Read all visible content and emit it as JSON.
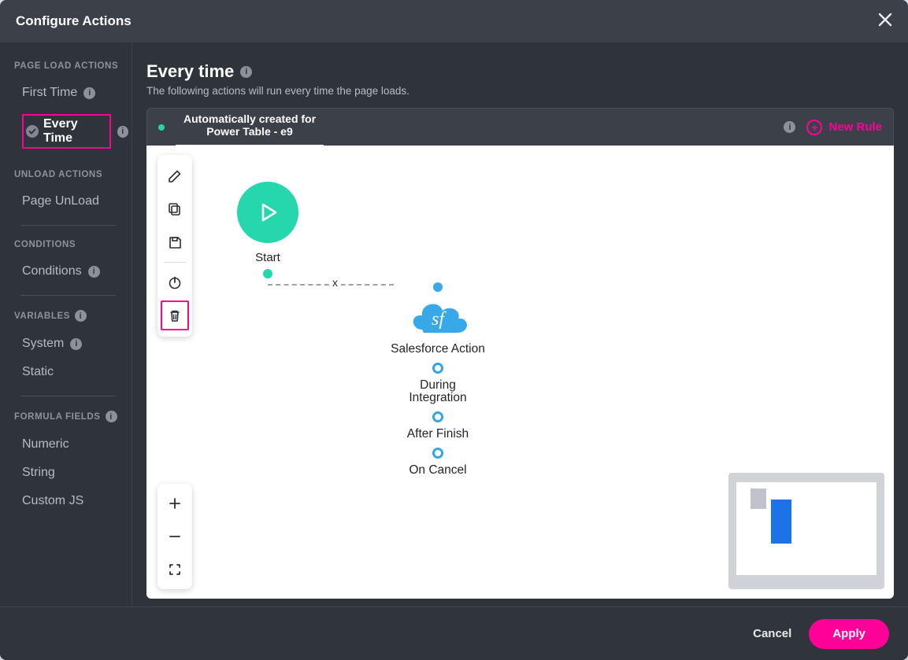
{
  "modal": {
    "title": "Configure Actions"
  },
  "sidebar": {
    "headers": {
      "page_load": "PAGE LOAD ACTIONS",
      "unload": "UNLOAD ACTIONS",
      "conditions": "CONDITIONS",
      "variables": "VARIABLES",
      "formula": "FORMULA FIELDS"
    },
    "items": {
      "first_time": "First Time",
      "every_time": "Every Time",
      "page_unload": "Page UnLoad",
      "conditions": "Conditions",
      "system": "System",
      "static": "Static",
      "numeric": "Numeric",
      "string": "String",
      "custom_js": "Custom JS"
    }
  },
  "main": {
    "title": "Every time",
    "subtitle": "The following actions will run every time the page loads.",
    "rule_tab_line1": "Automatically created for",
    "rule_tab_line2": "Power Table - e9",
    "new_rule": "New Rule"
  },
  "flow": {
    "start_label": "Start",
    "edge_x": "x",
    "sf_action": "Salesforce Action",
    "during": "During",
    "integration": "Integration",
    "after_finish": "After Finish",
    "on_cancel": "On Cancel",
    "cloud_text": "sf"
  },
  "footer": {
    "cancel": "Cancel",
    "apply": "Apply"
  },
  "info_badge": "i"
}
